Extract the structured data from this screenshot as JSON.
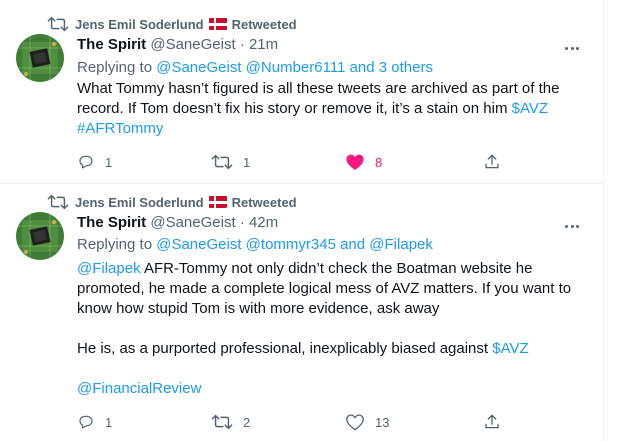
{
  "tweets": [
    {
      "retweeted_by": "Jens Emil Soderlund",
      "retweet_label": "Retweeted",
      "name": "The Spirit",
      "handle": "@SaneGeist",
      "time": "21m",
      "reply_prefix": "Replying to",
      "reply_mention_1": "@SaneGeist",
      "reply_mention_2": "@Number6111",
      "reply_joiner": "and",
      "reply_mention_3": "3 others",
      "text_line_1": "What Tommy hasn’t figured is all these tweets are archived as part of the",
      "text_line_2": "record. If Tom doesn’t fix his story or remove it, it’s a stain on him",
      "cashtag": "$AVZ",
      "hashtag": "#AFRTommy",
      "replies": "1",
      "retweets": "1",
      "likes": "8"
    },
    {
      "retweeted_by": "Jens Emil Soderlund",
      "retweet_label": "Retweeted",
      "name": "The Spirit",
      "handle": "@SaneGeist",
      "time": "42m",
      "reply_prefix": "Replying to",
      "reply_mention_1": "@SaneGeist",
      "reply_mention_2": "@tommyr345",
      "reply_joiner": "and",
      "reply_mention_3": "@Filapek",
      "text_mention": "@Filapek",
      "text_line_1": "AFR-Tommy not only didn’t check the Boatman website he",
      "text_line_2": "promoted, he made a complete logical mess of AVZ matters. If you want to",
      "text_line_3": "know how stupid Tom is with more evidence, ask away",
      "text_line_4": "He is, as a purported professional, inexplicably biased against",
      "cashtag": "$AVZ",
      "text_mention_2": "@FinancialReview",
      "replies": "1",
      "retweets": "2",
      "likes": "13"
    }
  ],
  "colors": {
    "link": "#1d9bf0",
    "muted": "#536471",
    "like": "#f91880",
    "avatar_bg": "#4a8a3a",
    "flag": "#c8102e"
  },
  "icons": [
    "retweet-icon",
    "denmark-flag-icon",
    "more-options-icon",
    "reply-icon",
    "heart-icon",
    "share-icon"
  ]
}
